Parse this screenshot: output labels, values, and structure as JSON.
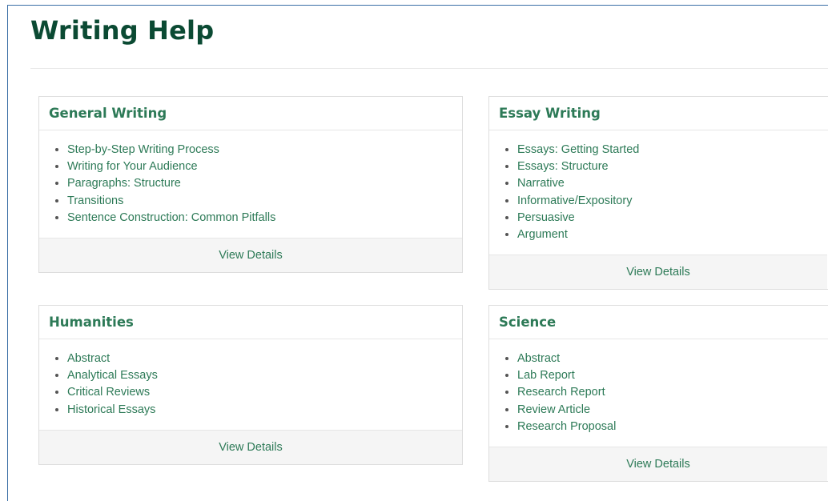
{
  "page": {
    "title": "Writing Help"
  },
  "colors": {
    "title": "#0b4a33",
    "accent": "#2d7a57",
    "footer_bg": "#f5f5f5",
    "border": "#dddddd"
  },
  "cards": [
    {
      "title": "General Writing",
      "items": [
        "Step-by-Step Writing Process",
        "Writing for Your Audience",
        "Paragraphs: Structure",
        "Transitions",
        "Sentence Construction: Common Pitfalls"
      ],
      "footer_label": "View Details"
    },
    {
      "title": "Essay Writing",
      "items": [
        "Essays: Getting Started",
        "Essays: Structure",
        "Narrative",
        "Informative/Expository",
        "Persuasive",
        "Argument"
      ],
      "footer_label": "View Details"
    },
    {
      "title": "Humanities",
      "items": [
        "Abstract",
        "Analytical Essays",
        "Critical Reviews",
        "Historical Essays"
      ],
      "footer_label": "View Details"
    },
    {
      "title": "Science",
      "items": [
        "Abstract",
        "Lab Report",
        "Research Report",
        "Review Article",
        "Research Proposal"
      ],
      "footer_label": "View Details"
    }
  ]
}
